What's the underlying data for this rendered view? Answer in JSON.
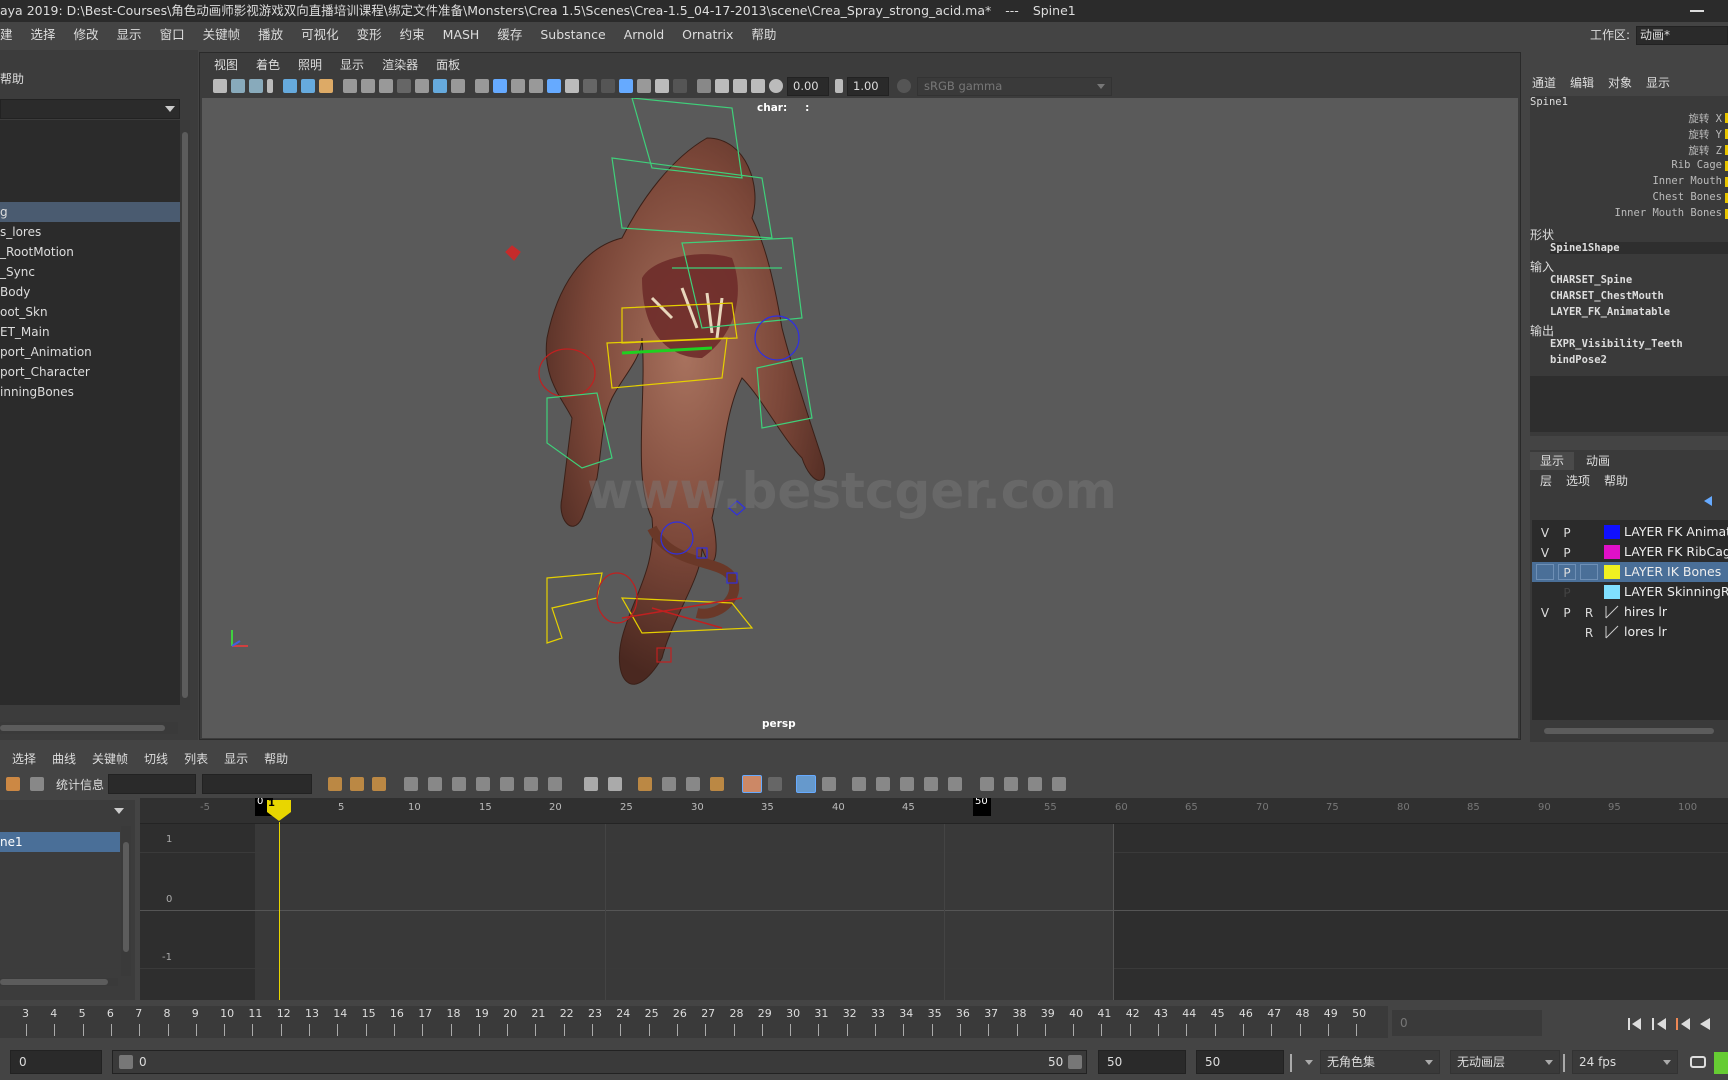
{
  "title_bar": {
    "text": "aya 2019: D:\\Best-Courses\\角色动画师影视游戏双向直播培训课程\\绑定文件准备\\Monsters\\Crea 1.5\\Scenes\\Crea-1.5_04-17-2013\\scene\\Crea_Spray_strong_acid.ma*",
    "sep": "---",
    "node": "Spine1"
  },
  "menu_bar": [
    "建",
    "选择",
    "修改",
    "显示",
    "窗口",
    "关键帧",
    "播放",
    "可视化",
    "变形",
    "约束",
    "MASH",
    "缓存",
    "Substance",
    "Arnold",
    "Ornatrix",
    "帮助"
  ],
  "workspace": {
    "label": "工作区:",
    "value": "动画*"
  },
  "outliner": {
    "help": "帮助",
    "items": [
      "g",
      "s_lores",
      "_RootMotion",
      "_Sync",
      "Body",
      "oot_Skn",
      "ET_Main",
      "port_Animation",
      "port_Character",
      "inningBones"
    ]
  },
  "viewport": {
    "menu": [
      "视图",
      "着色",
      "照明",
      "显示",
      "渲染器",
      "面板"
    ],
    "exposure": "0.00",
    "gamma_val": "1.00",
    "color_space": "sRGB gamma",
    "char_label": "char:",
    "char_value": ":",
    "camera": "persp",
    "watermark": "www.bestcger.com"
  },
  "channel_box": {
    "tabs": [
      "通道",
      "编辑",
      "对象",
      "显示"
    ],
    "node": "Spine1",
    "attributes": [
      "旋转 X",
      "旋转 Y",
      "旋转 Z",
      "Rib Cage",
      "Inner Mouth",
      "Chest Bones",
      "Inner Mouth Bones"
    ],
    "shape_label": "形状",
    "shape": "Spine1Shape",
    "inputs_label": "输入",
    "inputs": [
      "CHARSET_Spine",
      "CHARSET_ChestMouth",
      "LAYER_FK_Animatable"
    ],
    "outputs_label": "输出",
    "outputs": [
      "EXPR_Visibility_Teeth",
      "bindPose2"
    ]
  },
  "layer_editor": {
    "tabs": [
      "显示",
      "动画"
    ],
    "menu": [
      "层",
      "选项",
      "帮助"
    ],
    "layers": [
      {
        "v": "V",
        "p": "P",
        "r": "",
        "color": "#1010ff",
        "name": "LAYER FK Animata"
      },
      {
        "v": "V",
        "p": "P",
        "r": "",
        "color": "#e010c8",
        "name": "LAYER FK RibCag"
      },
      {
        "v": "",
        "p": "P",
        "r": "",
        "color": "#f0f020",
        "name": "LAYER IK Bones"
      },
      {
        "v": "",
        "p": "P",
        "r": "",
        "color": "#80e0ff",
        "name": "LAYER SkinningRi"
      },
      {
        "v": "V",
        "p": "P",
        "r": "R",
        "color": "",
        "name": "hires lr"
      },
      {
        "v": "",
        "p": "",
        "r": "R",
        "color": "",
        "name": "lores lr"
      }
    ]
  },
  "graph_editor": {
    "menu": [
      "选择",
      "曲线",
      "关键帧",
      "切线",
      "列表",
      "显示",
      "帮助"
    ],
    "stats_label": "统计信息",
    "selected_curve": "ne1",
    "ruler_ticks": [
      "-5",
      "0",
      "1",
      "5",
      "10",
      "15",
      "20",
      "25",
      "30",
      "35",
      "40",
      "45",
      "50",
      "55",
      "60",
      "65",
      "70",
      "75",
      "80",
      "85",
      "90",
      "95",
      "100"
    ],
    "y_ticks": [
      "1",
      "0",
      "-1"
    ]
  },
  "time_slider": {
    "frames": [
      "3",
      "4",
      "5",
      "6",
      "7",
      "8",
      "9",
      "10",
      "11",
      "12",
      "13",
      "14",
      "15",
      "16",
      "17",
      "18",
      "19",
      "20",
      "21",
      "22",
      "23",
      "24",
      "25",
      "26",
      "27",
      "28",
      "29",
      "30",
      "31",
      "32",
      "33",
      "34",
      "35",
      "36",
      "37",
      "38",
      "39",
      "40",
      "41",
      "42",
      "43",
      "44",
      "45",
      "46",
      "47",
      "48",
      "49",
      "50"
    ],
    "current_frame": "0"
  },
  "range_slider": {
    "start": "0",
    "range_start": "0",
    "range_end": "50",
    "end": "50",
    "anim_end": "50",
    "char_set": "无角色集",
    "anim_layer": "无动画层",
    "fps": "24 fps"
  }
}
